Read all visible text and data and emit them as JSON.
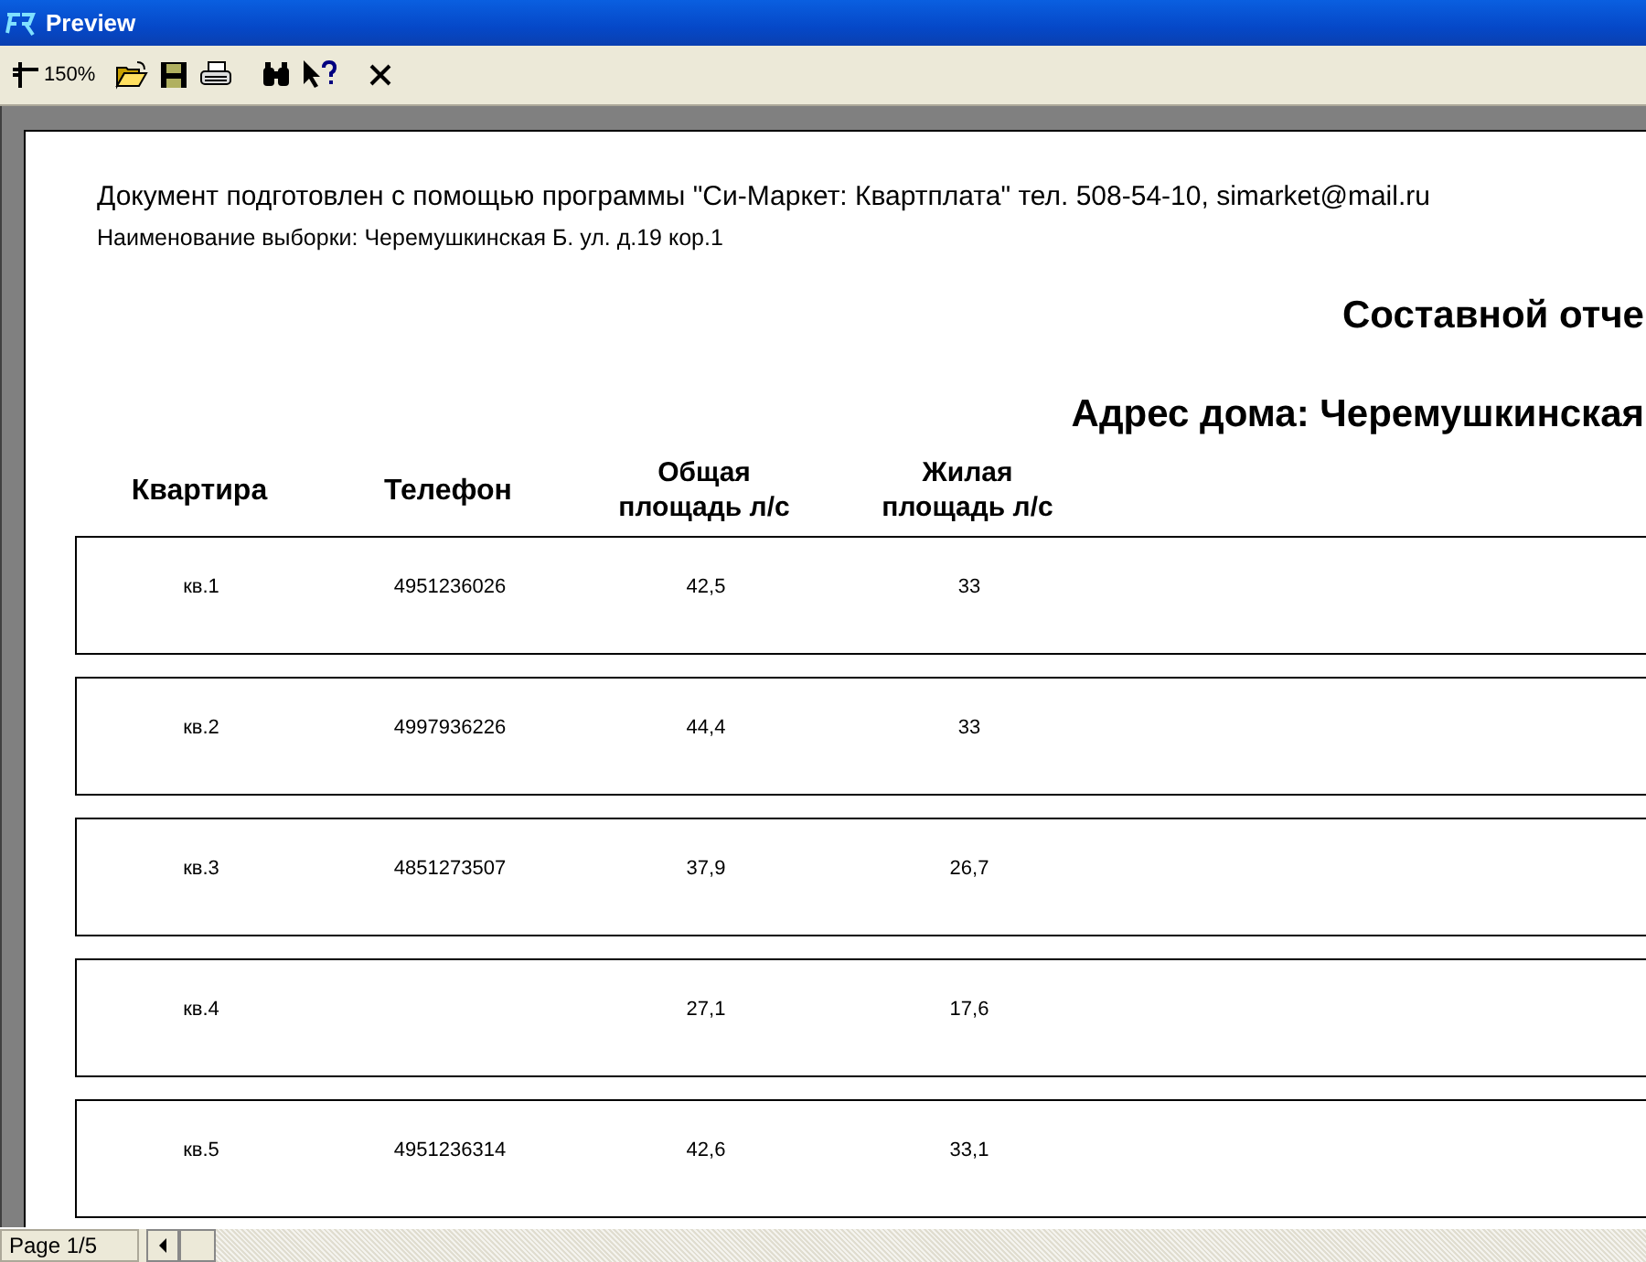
{
  "window": {
    "title": "Preview"
  },
  "toolbar": {
    "zoom": "150%"
  },
  "document": {
    "header_line": "Документ подготовлен с помощью программы \"Си-Маркет: Квартплата\" тел. 508-54-10, simarket@mail.ru",
    "selection_line": "Наименование выборки: Черемушкинская Б. ул. д.19 кор.1",
    "report_title": "Составной отче",
    "address_title": "Адрес дома: Черемушкинская",
    "columns": [
      "Квартира",
      "Телефон",
      "Общая площадь л/с",
      "Жилая площадь л/с"
    ],
    "rows": [
      {
        "apartment": "кв.1",
        "phone": "4951236026",
        "total_area": "42,5",
        "living_area": "33"
      },
      {
        "apartment": "кв.2",
        "phone": "4997936226",
        "total_area": "44,4",
        "living_area": "33"
      },
      {
        "apartment": "кв.3",
        "phone": "4851273507",
        "total_area": "37,9",
        "living_area": "26,7"
      },
      {
        "apartment": "кв.4",
        "total_area": "27,1",
        "living_area": "17,6"
      },
      {
        "apartment": "кв.5",
        "phone": "4951236314",
        "total_area": "42,6",
        "living_area": "33,1"
      }
    ]
  },
  "status_bar": {
    "page": "Page 1/5"
  }
}
